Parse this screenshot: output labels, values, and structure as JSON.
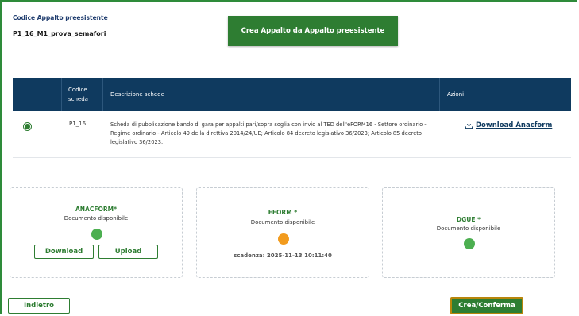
{
  "form": {
    "preexisting_label": "Codice Appalto preesistente",
    "preexisting_value": "P1_16_M1_prova_semafori",
    "create_from_preexisting_button": "Crea Appalto da Appalto preesistente"
  },
  "table": {
    "headers": {
      "code": "Codice scheda",
      "description": "Descrizione schede",
      "actions": "Azioni"
    },
    "rows": [
      {
        "selected": true,
        "code": "P1_16",
        "description": "Scheda di pubblicazione bando di gara per appalti pari/sopra soglia con invio al TED dell'eFORM16 - Settore ordinario - Regime ordinario - Articolo 49 della direttiva 2014/24/UE; Articolo 84 decreto legislativo 36/2023; Articolo 85 decreto legislativo 36/2023.",
        "action_label": "Download Anacform",
        "action_icon": "download-icon"
      }
    ]
  },
  "cards": {
    "anacform": {
      "title": "ANACFORM*",
      "status": "Documento disponibile",
      "status_color": "#4caf50",
      "download_label": "Download",
      "upload_label": "Upload"
    },
    "eform": {
      "title": "EFORM *",
      "status": "Documento disponibile",
      "status_color": "#f29b1e",
      "deadline": "scadenza: 2025-11-13 10:11:40"
    },
    "dgue": {
      "title": "DGUE *",
      "status": "Documento disponibile",
      "status_color": "#4caf50"
    }
  },
  "footer": {
    "back_label": "Indietro",
    "confirm_label": "Crea/Conferma"
  },
  "colors": {
    "primary_green": "#2e7d32",
    "header_navy": "#0f3a5f"
  }
}
